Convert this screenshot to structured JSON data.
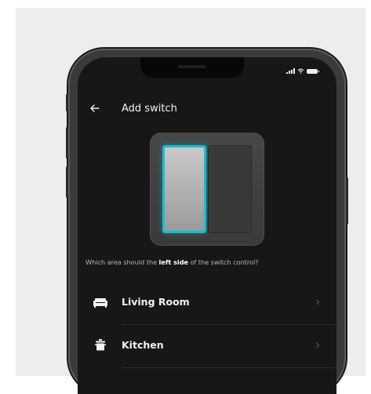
{
  "header": {
    "title": "Add switch",
    "back_icon": "arrow-left-icon"
  },
  "status_bar": {
    "icons": [
      "signal-icon",
      "wifi-icon",
      "battery-icon"
    ]
  },
  "prompt": {
    "before": "Which area should the ",
    "emphasis": "left side",
    "after": " of the switch control?"
  },
  "switch_preview": {
    "selected_side": "left",
    "accent_color": "#14c0d0"
  },
  "rooms": [
    {
      "label": "Living Room",
      "icon": "sofa-icon"
    },
    {
      "label": "Kitchen",
      "icon": "pot-icon"
    }
  ]
}
